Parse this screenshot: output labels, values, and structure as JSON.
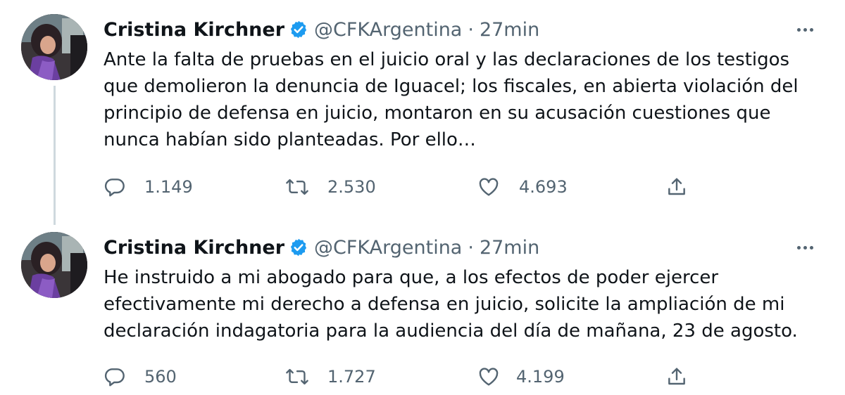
{
  "tweets": [
    {
      "author": {
        "name": "Cristina Kirchner",
        "handle": "@CFKArgentina",
        "verified": true
      },
      "separator": "·",
      "time": "27min",
      "text": "Ante la falta de pruebas en el juicio oral y las declaraciones de los testigos que demolieron la denuncia de Iguacel; los fiscales, en abierta violación del principio de defensa en juicio, montaron en su acusación cuestiones que nunca habían sido planteadas. Por ello…",
      "stats": {
        "replies": "1.149",
        "retweets": "2.530",
        "likes": "4.693"
      }
    },
    {
      "author": {
        "name": "Cristina Kirchner",
        "handle": "@CFKArgentina",
        "verified": true
      },
      "separator": "·",
      "time": "27min",
      "text": "He instruido a mi abogado para que, a los efectos de poder ejercer efectivamente mi derecho a defensa en juicio, solicite la ampliación de mi declaración indagatoria para la audiencia del día de mañana, 23 de agosto.",
      "stats": {
        "replies": "560",
        "retweets": "1.727",
        "likes": "4.199"
      }
    }
  ],
  "icons": {
    "verified": "verified-badge-icon",
    "more": "more-horizontal-icon",
    "reply": "reply-icon",
    "retweet": "retweet-icon",
    "like": "heart-icon",
    "share": "share-icon"
  },
  "colors": {
    "text": "#0f1419",
    "secondary": "#536471",
    "verified": "#1d9bf0",
    "thread_line": "#cfd9de"
  }
}
